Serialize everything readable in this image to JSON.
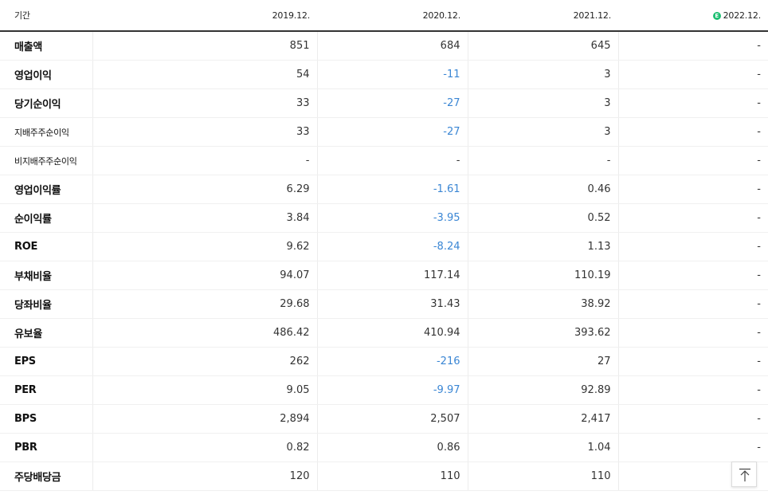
{
  "header": {
    "label": "기간",
    "years": [
      "2019.12.",
      "2020.12.",
      "2021.12.",
      "2022.12."
    ],
    "estimate_icon_letter": "E",
    "estimate_icon_color": "#1fbf73"
  },
  "rows": [
    {
      "label": "매출액",
      "values": [
        "851",
        "684",
        "645",
        "-"
      ]
    },
    {
      "label": "영업이익",
      "values": [
        "54",
        "-11",
        "3",
        "-"
      ]
    },
    {
      "label": "당기순이익",
      "values": [
        "33",
        "-27",
        "3",
        "-"
      ]
    },
    {
      "label": "지배주주순이익",
      "values": [
        "33",
        "-27",
        "3",
        "-"
      ]
    },
    {
      "label": "비지배주주순이익",
      "values": [
        "-",
        "-",
        "-",
        "-"
      ]
    },
    {
      "label": "영업이익률",
      "values": [
        "6.29",
        "-1.61",
        "0.46",
        "-"
      ]
    },
    {
      "label": "순이익률",
      "values": [
        "3.84",
        "-3.95",
        "0.52",
        "-"
      ]
    },
    {
      "label": "ROE",
      "values": [
        "9.62",
        "-8.24",
        "1.13",
        "-"
      ]
    },
    {
      "label": "부채비율",
      "values": [
        "94.07",
        "117.14",
        "110.19",
        "-"
      ]
    },
    {
      "label": "당좌비율",
      "values": [
        "29.68",
        "31.43",
        "38.92",
        "-"
      ]
    },
    {
      "label": "유보율",
      "values": [
        "486.42",
        "410.94",
        "393.62",
        "-"
      ]
    },
    {
      "label": "EPS",
      "values": [
        "262",
        "-216",
        "27",
        "-"
      ]
    },
    {
      "label": "PER",
      "values": [
        "9.05",
        "-9.97",
        "92.89",
        "-"
      ]
    },
    {
      "label": "BPS",
      "values": [
        "2,894",
        "2,507",
        "2,417",
        "-"
      ]
    },
    {
      "label": "PBR",
      "values": [
        "0.82",
        "0.86",
        "1.04",
        "-"
      ]
    },
    {
      "label": "주당배당금",
      "values": [
        "120",
        "110",
        "110",
        ""
      ]
    }
  ],
  "colors": {
    "negative": "#3a86d4",
    "header_rule": "#333333",
    "group_rule": "#c8c8c8"
  },
  "top_button": {
    "icon": "arrow-up-to-top-icon"
  }
}
